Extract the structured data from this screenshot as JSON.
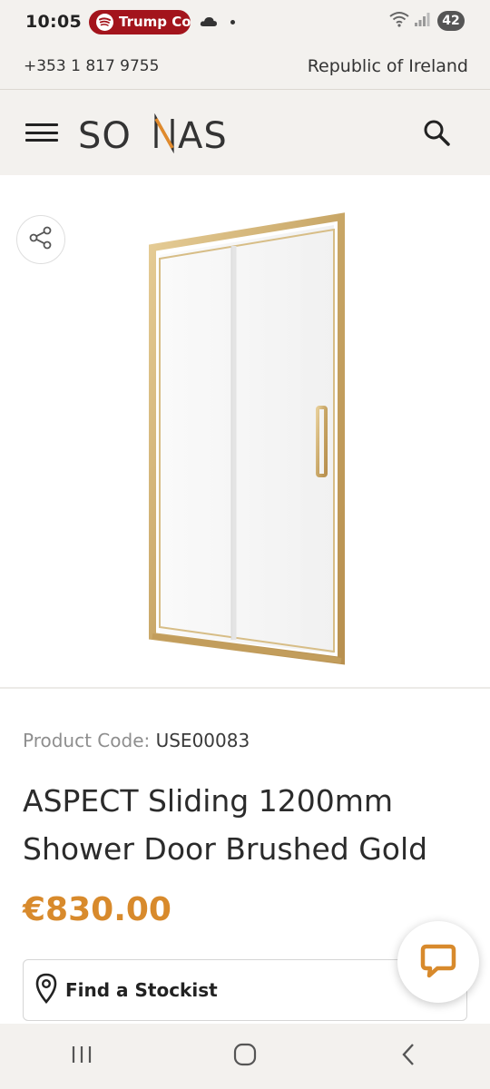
{
  "status_bar": {
    "time": "10:05",
    "notification": "Trump Co",
    "battery": "42",
    "icons": [
      "spotify-icon",
      "cloud-icon",
      "dot-icon",
      "wifi-icon",
      "signal-icon",
      "battery-icon"
    ]
  },
  "top_bar": {
    "phone": "+353 1 817 9755",
    "region": "Republic of Ireland"
  },
  "header": {
    "brand": "SONAS",
    "icons": [
      "menu-icon",
      "search-icon"
    ]
  },
  "product": {
    "code_label": "Product Code: ",
    "code_value": "USE00083",
    "title": "ASPECT Sliding 1200mm Shower Door Brushed Gold",
    "price": "€830.00",
    "image_alt": "shower-door-image"
  },
  "actions": {
    "find_stockist": "Find a Stockist",
    "share_icon": "share-icon",
    "chat_icon": "chat-icon"
  },
  "colors": {
    "brand_orange": "#e08a2c",
    "price_orange": "#d88a2c",
    "notification_red": "#a3141c",
    "gold_frame": "#c8a666"
  }
}
